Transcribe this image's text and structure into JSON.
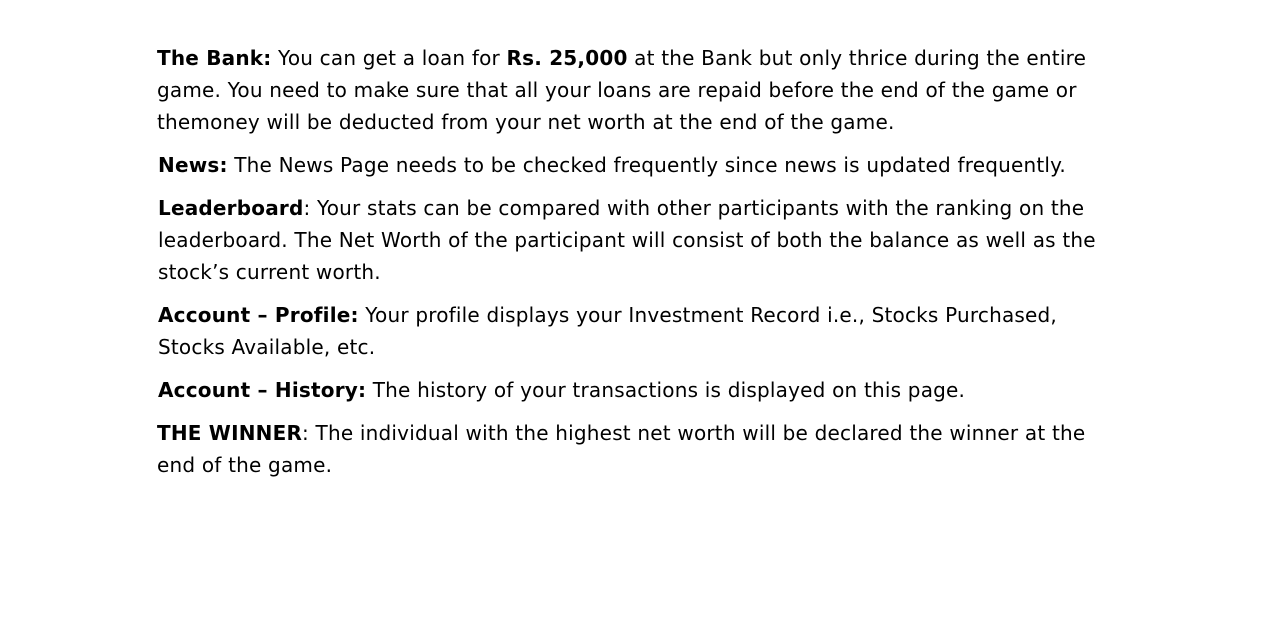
{
  "paragraphs": {
    "bank": {
      "term": "The Bank:",
      "text_1": " You can get a loan for ",
      "amount": "Rs. 25,000",
      "text_2": " at the Bank but only thrice during the entire game. You need to make sure that all your loans are repaid before the end of the game or themoney will be deducted from your net worth at the end of the game."
    },
    "news": {
      "term": "News:",
      "text": " The News Page needs to be checked frequently since news is updated frequently."
    },
    "leaderboard": {
      "term": "Leaderboard",
      "text": ": Your stats can be compared with other participants with the ranking on the leaderboard. The Net Worth of the participant will consist of both the balance as well as the stock’s current worth."
    },
    "account_profile": {
      "term": "Account – Profile:",
      "text": " Your profile displays your Investment Record i.e., Stocks Purchased, Stocks Available, etc."
    },
    "account_history": {
      "term": "Account – History:",
      "text": " The history of your transactions is displayed on this page."
    },
    "winner": {
      "term": "THE WINNER",
      "text": ": The individual with the highest net worth will be declared the winner at the end of the game."
    }
  }
}
